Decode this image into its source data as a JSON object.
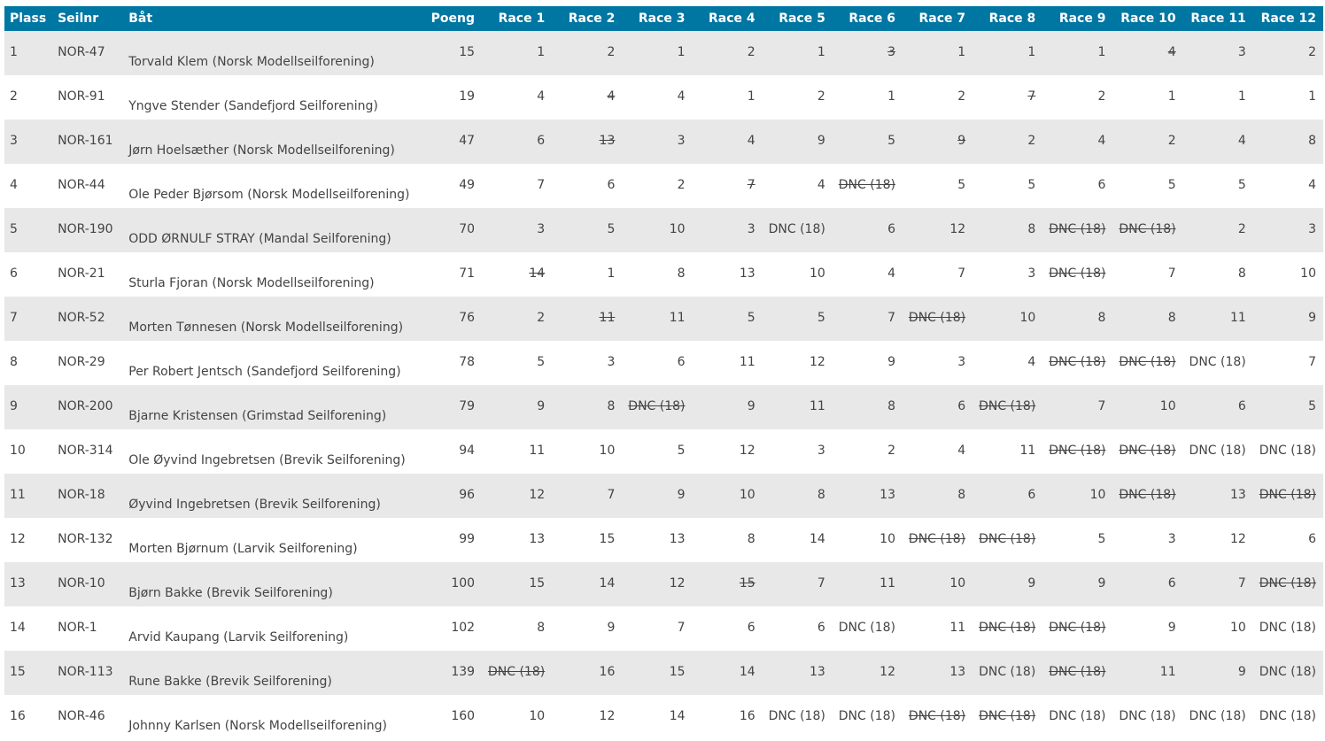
{
  "headers": {
    "plass": "Plass",
    "seilnr": "Seilnr",
    "baat": "Båt",
    "poeng": "Poeng",
    "races": [
      "Race 1",
      "Race 2",
      "Race 3",
      "Race 4",
      "Race 5",
      "Race 6",
      "Race 7",
      "Race 8",
      "Race 9",
      "Race 10",
      "Race 11",
      "Race 12"
    ]
  },
  "rows": [
    {
      "plass": "1",
      "seilnr": "NOR-47",
      "boat": "Torvald Klem (Norsk Modellseilforening)",
      "poeng": "15",
      "races": [
        {
          "v": "1",
          "d": false
        },
        {
          "v": "2",
          "d": false
        },
        {
          "v": "1",
          "d": false
        },
        {
          "v": "2",
          "d": false
        },
        {
          "v": "1",
          "d": false
        },
        {
          "v": "3",
          "d": true
        },
        {
          "v": "1",
          "d": false
        },
        {
          "v": "1",
          "d": false
        },
        {
          "v": "1",
          "d": false
        },
        {
          "v": "4",
          "d": true
        },
        {
          "v": "3",
          "d": false
        },
        {
          "v": "2",
          "d": false
        }
      ]
    },
    {
      "plass": "2",
      "seilnr": "NOR-91",
      "boat": "Yngve Stender (Sandefjord Seilforening)",
      "poeng": "19",
      "races": [
        {
          "v": "4",
          "d": false
        },
        {
          "v": "4",
          "d": true
        },
        {
          "v": "4",
          "d": false
        },
        {
          "v": "1",
          "d": false
        },
        {
          "v": "2",
          "d": false
        },
        {
          "v": "1",
          "d": false
        },
        {
          "v": "2",
          "d": false
        },
        {
          "v": "7",
          "d": true
        },
        {
          "v": "2",
          "d": false
        },
        {
          "v": "1",
          "d": false
        },
        {
          "v": "1",
          "d": false
        },
        {
          "v": "1",
          "d": false
        }
      ]
    },
    {
      "plass": "3",
      "seilnr": "NOR-161",
      "boat": "Jørn Hoelsæther (Norsk Modellseilforening)",
      "poeng": "47",
      "races": [
        {
          "v": "6",
          "d": false
        },
        {
          "v": "13",
          "d": true
        },
        {
          "v": "3",
          "d": false
        },
        {
          "v": "4",
          "d": false
        },
        {
          "v": "9",
          "d": false
        },
        {
          "v": "5",
          "d": false
        },
        {
          "v": "9",
          "d": true
        },
        {
          "v": "2",
          "d": false
        },
        {
          "v": "4",
          "d": false
        },
        {
          "v": "2",
          "d": false
        },
        {
          "v": "4",
          "d": false
        },
        {
          "v": "8",
          "d": false
        }
      ]
    },
    {
      "plass": "4",
      "seilnr": "NOR-44",
      "boat": "Ole Peder Bjørsom (Norsk Modellseilforening)",
      "poeng": "49",
      "races": [
        {
          "v": "7",
          "d": false
        },
        {
          "v": "6",
          "d": false
        },
        {
          "v": "2",
          "d": false
        },
        {
          "v": "7",
          "d": true
        },
        {
          "v": "4",
          "d": false
        },
        {
          "v": "DNC (18)",
          "d": true
        },
        {
          "v": "5",
          "d": false
        },
        {
          "v": "5",
          "d": false
        },
        {
          "v": "6",
          "d": false
        },
        {
          "v": "5",
          "d": false
        },
        {
          "v": "5",
          "d": false
        },
        {
          "v": "4",
          "d": false
        }
      ]
    },
    {
      "plass": "5",
      "seilnr": "NOR-190",
      "boat": "ODD ØRNULF STRAY (Mandal Seilforening)",
      "poeng": "70",
      "races": [
        {
          "v": "3",
          "d": false
        },
        {
          "v": "5",
          "d": false
        },
        {
          "v": "10",
          "d": false
        },
        {
          "v": "3",
          "d": false
        },
        {
          "v": "DNC (18)",
          "d": false
        },
        {
          "v": "6",
          "d": false
        },
        {
          "v": "12",
          "d": false
        },
        {
          "v": "8",
          "d": false
        },
        {
          "v": "DNC (18)",
          "d": true
        },
        {
          "v": "DNC (18)",
          "d": true
        },
        {
          "v": "2",
          "d": false
        },
        {
          "v": "3",
          "d": false
        }
      ]
    },
    {
      "plass": "6",
      "seilnr": "NOR-21",
      "boat": "Sturla Fjoran (Norsk Modellseilforening)",
      "poeng": "71",
      "races": [
        {
          "v": "14",
          "d": true
        },
        {
          "v": "1",
          "d": false
        },
        {
          "v": "8",
          "d": false
        },
        {
          "v": "13",
          "d": false
        },
        {
          "v": "10",
          "d": false
        },
        {
          "v": "4",
          "d": false
        },
        {
          "v": "7",
          "d": false
        },
        {
          "v": "3",
          "d": false
        },
        {
          "v": "DNC (18)",
          "d": true
        },
        {
          "v": "7",
          "d": false
        },
        {
          "v": "8",
          "d": false
        },
        {
          "v": "10",
          "d": false
        }
      ]
    },
    {
      "plass": "7",
      "seilnr": "NOR-52",
      "boat": "Morten Tønnesen (Norsk Modellseilforening)",
      "poeng": "76",
      "races": [
        {
          "v": "2",
          "d": false
        },
        {
          "v": "11",
          "d": true
        },
        {
          "v": "11",
          "d": false
        },
        {
          "v": "5",
          "d": false
        },
        {
          "v": "5",
          "d": false
        },
        {
          "v": "7",
          "d": false
        },
        {
          "v": "DNC (18)",
          "d": true
        },
        {
          "v": "10",
          "d": false
        },
        {
          "v": "8",
          "d": false
        },
        {
          "v": "8",
          "d": false
        },
        {
          "v": "11",
          "d": false
        },
        {
          "v": "9",
          "d": false
        }
      ]
    },
    {
      "plass": "8",
      "seilnr": "NOR-29",
      "boat": "Per Robert Jentsch (Sandefjord Seilforening)",
      "poeng": "78",
      "races": [
        {
          "v": "5",
          "d": false
        },
        {
          "v": "3",
          "d": false
        },
        {
          "v": "6",
          "d": false
        },
        {
          "v": "11",
          "d": false
        },
        {
          "v": "12",
          "d": false
        },
        {
          "v": "9",
          "d": false
        },
        {
          "v": "3",
          "d": false
        },
        {
          "v": "4",
          "d": false
        },
        {
          "v": "DNC (18)",
          "d": true
        },
        {
          "v": "DNC (18)",
          "d": true
        },
        {
          "v": "DNC (18)",
          "d": false
        },
        {
          "v": "7",
          "d": false
        }
      ]
    },
    {
      "plass": "9",
      "seilnr": "NOR-200",
      "boat": "Bjarne Kristensen (Grimstad Seilforening)",
      "poeng": "79",
      "races": [
        {
          "v": "9",
          "d": false
        },
        {
          "v": "8",
          "d": false
        },
        {
          "v": "DNC (18)",
          "d": true
        },
        {
          "v": "9",
          "d": false
        },
        {
          "v": "11",
          "d": false
        },
        {
          "v": "8",
          "d": false
        },
        {
          "v": "6",
          "d": false
        },
        {
          "v": "DNC (18)",
          "d": true
        },
        {
          "v": "7",
          "d": false
        },
        {
          "v": "10",
          "d": false
        },
        {
          "v": "6",
          "d": false
        },
        {
          "v": "5",
          "d": false
        }
      ]
    },
    {
      "plass": "10",
      "seilnr": "NOR-314",
      "boat": "Ole Øyvind Ingebretsen (Brevik Seilforening)",
      "poeng": "94",
      "races": [
        {
          "v": "11",
          "d": false
        },
        {
          "v": "10",
          "d": false
        },
        {
          "v": "5",
          "d": false
        },
        {
          "v": "12",
          "d": false
        },
        {
          "v": "3",
          "d": false
        },
        {
          "v": "2",
          "d": false
        },
        {
          "v": "4",
          "d": false
        },
        {
          "v": "11",
          "d": false
        },
        {
          "v": "DNC (18)",
          "d": true
        },
        {
          "v": "DNC (18)",
          "d": true
        },
        {
          "v": "DNC (18)",
          "d": false
        },
        {
          "v": "DNC (18)",
          "d": false
        }
      ]
    },
    {
      "plass": "11",
      "seilnr": "NOR-18",
      "boat": "Øyvind Ingebretsen (Brevik Seilforening)",
      "poeng": "96",
      "races": [
        {
          "v": "12",
          "d": false
        },
        {
          "v": "7",
          "d": false
        },
        {
          "v": "9",
          "d": false
        },
        {
          "v": "10",
          "d": false
        },
        {
          "v": "8",
          "d": false
        },
        {
          "v": "13",
          "d": false
        },
        {
          "v": "8",
          "d": false
        },
        {
          "v": "6",
          "d": false
        },
        {
          "v": "10",
          "d": false
        },
        {
          "v": "DNC (18)",
          "d": true
        },
        {
          "v": "13",
          "d": false
        },
        {
          "v": "DNC (18)",
          "d": true
        }
      ]
    },
    {
      "plass": "12",
      "seilnr": "NOR-132",
      "boat": "Morten Bjørnum (Larvik Seilforening)",
      "poeng": "99",
      "races": [
        {
          "v": "13",
          "d": false
        },
        {
          "v": "15",
          "d": false
        },
        {
          "v": "13",
          "d": false
        },
        {
          "v": "8",
          "d": false
        },
        {
          "v": "14",
          "d": false
        },
        {
          "v": "10",
          "d": false
        },
        {
          "v": "DNC (18)",
          "d": true
        },
        {
          "v": "DNC (18)",
          "d": true
        },
        {
          "v": "5",
          "d": false
        },
        {
          "v": "3",
          "d": false
        },
        {
          "v": "12",
          "d": false
        },
        {
          "v": "6",
          "d": false
        }
      ]
    },
    {
      "plass": "13",
      "seilnr": "NOR-10",
      "boat": "Bjørn Bakke (Brevik Seilforening)",
      "poeng": "100",
      "races": [
        {
          "v": "15",
          "d": false
        },
        {
          "v": "14",
          "d": false
        },
        {
          "v": "12",
          "d": false
        },
        {
          "v": "15",
          "d": true
        },
        {
          "v": "7",
          "d": false
        },
        {
          "v": "11",
          "d": false
        },
        {
          "v": "10",
          "d": false
        },
        {
          "v": "9",
          "d": false
        },
        {
          "v": "9",
          "d": false
        },
        {
          "v": "6",
          "d": false
        },
        {
          "v": "7",
          "d": false
        },
        {
          "v": "DNC (18)",
          "d": true
        }
      ]
    },
    {
      "plass": "14",
      "seilnr": "NOR-1",
      "boat": "Arvid Kaupang (Larvik Seilforening)",
      "poeng": "102",
      "races": [
        {
          "v": "8",
          "d": false
        },
        {
          "v": "9",
          "d": false
        },
        {
          "v": "7",
          "d": false
        },
        {
          "v": "6",
          "d": false
        },
        {
          "v": "6",
          "d": false
        },
        {
          "v": "DNC (18)",
          "d": false
        },
        {
          "v": "11",
          "d": false
        },
        {
          "v": "DNC (18)",
          "d": true
        },
        {
          "v": "DNC (18)",
          "d": true
        },
        {
          "v": "9",
          "d": false
        },
        {
          "v": "10",
          "d": false
        },
        {
          "v": "DNC (18)",
          "d": false
        }
      ]
    },
    {
      "plass": "15",
      "seilnr": "NOR-113",
      "boat": "Rune Bakke (Brevik Seilforening)",
      "poeng": "139",
      "races": [
        {
          "v": "DNC (18)",
          "d": true
        },
        {
          "v": "16",
          "d": false
        },
        {
          "v": "15",
          "d": false
        },
        {
          "v": "14",
          "d": false
        },
        {
          "v": "13",
          "d": false
        },
        {
          "v": "12",
          "d": false
        },
        {
          "v": "13",
          "d": false
        },
        {
          "v": "DNC (18)",
          "d": false
        },
        {
          "v": "DNC (18)",
          "d": true
        },
        {
          "v": "11",
          "d": false
        },
        {
          "v": "9",
          "d": false
        },
        {
          "v": "DNC (18)",
          "d": false
        }
      ]
    },
    {
      "plass": "16",
      "seilnr": "NOR-46",
      "boat": "Johnny Karlsen (Norsk Modellseilforening)",
      "poeng": "160",
      "races": [
        {
          "v": "10",
          "d": false
        },
        {
          "v": "12",
          "d": false
        },
        {
          "v": "14",
          "d": false
        },
        {
          "v": "16",
          "d": false
        },
        {
          "v": "DNC (18)",
          "d": false
        },
        {
          "v": "DNC (18)",
          "d": false
        },
        {
          "v": "DNC (18)",
          "d": true
        },
        {
          "v": "DNC (18)",
          "d": true
        },
        {
          "v": "DNC (18)",
          "d": false
        },
        {
          "v": "DNC (18)",
          "d": false
        },
        {
          "v": "DNC (18)",
          "d": false
        },
        {
          "v": "DNC (18)",
          "d": false
        }
      ]
    }
  ]
}
